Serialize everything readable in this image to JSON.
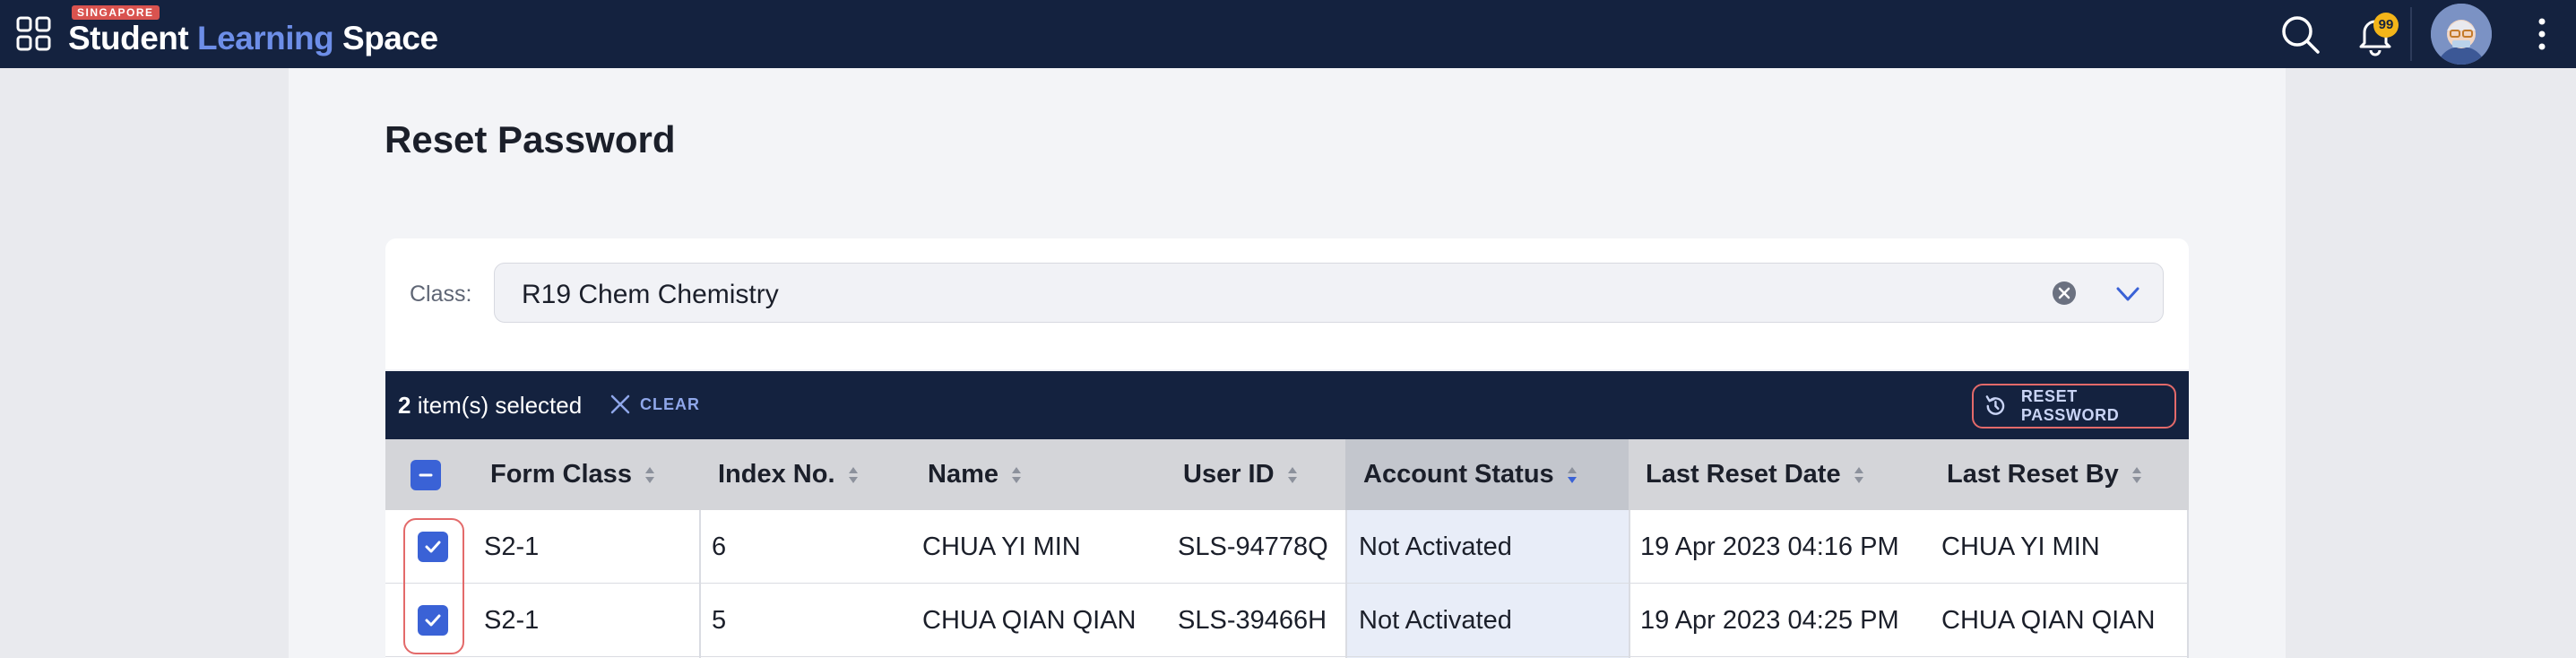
{
  "header": {
    "logo_badge": "SINGAPORE",
    "logo_part1": "Student",
    "logo_part2": "Learning",
    "logo_part3": "Space",
    "notification_count": "99"
  },
  "page": {
    "title": "Reset Password"
  },
  "class_filter": {
    "label": "Class:",
    "value": "R19 Chem Chemistry"
  },
  "selection_bar": {
    "count": "2",
    "count_suffix": " item(s) selected",
    "clear_label": "CLEAR",
    "reset_label": "RESET PASSWORD"
  },
  "table": {
    "columns": [
      "Form Class",
      "Index No.",
      "Name",
      "User ID",
      "Account Status",
      "Last Reset Date",
      "Last Reset By"
    ],
    "sorted_column": "Account Status",
    "rows": [
      {
        "form_class": "S2-1",
        "index_no": "6",
        "name": "CHUA YI MIN",
        "user_id": "SLS-94778Q",
        "account_status": "Not Activated",
        "last_reset_date": "19 Apr 2023 04:16 PM",
        "last_reset_by": "CHUA YI MIN",
        "checked": true
      },
      {
        "form_class": "S2-1",
        "index_no": "5",
        "name": "CHUA QIAN QIAN",
        "user_id": "SLS-39466H",
        "account_status": "Not Activated",
        "last_reset_date": "19 Apr 2023 04:25 PM",
        "last_reset_by": "CHUA QIAN QIAN",
        "checked": true
      }
    ]
  },
  "colors": {
    "navbar": "#14223f",
    "accent": "#3a62d6",
    "highlight": "#e36a6a",
    "badge": "#f3b519"
  },
  "icons": [
    "apps-grid-icon",
    "search-icon",
    "bell-icon",
    "avatar",
    "kebab-menu-icon",
    "clear-circle-icon",
    "chevron-down-icon",
    "close-icon",
    "reset-icon",
    "sort-icon",
    "checkbox-icon"
  ]
}
